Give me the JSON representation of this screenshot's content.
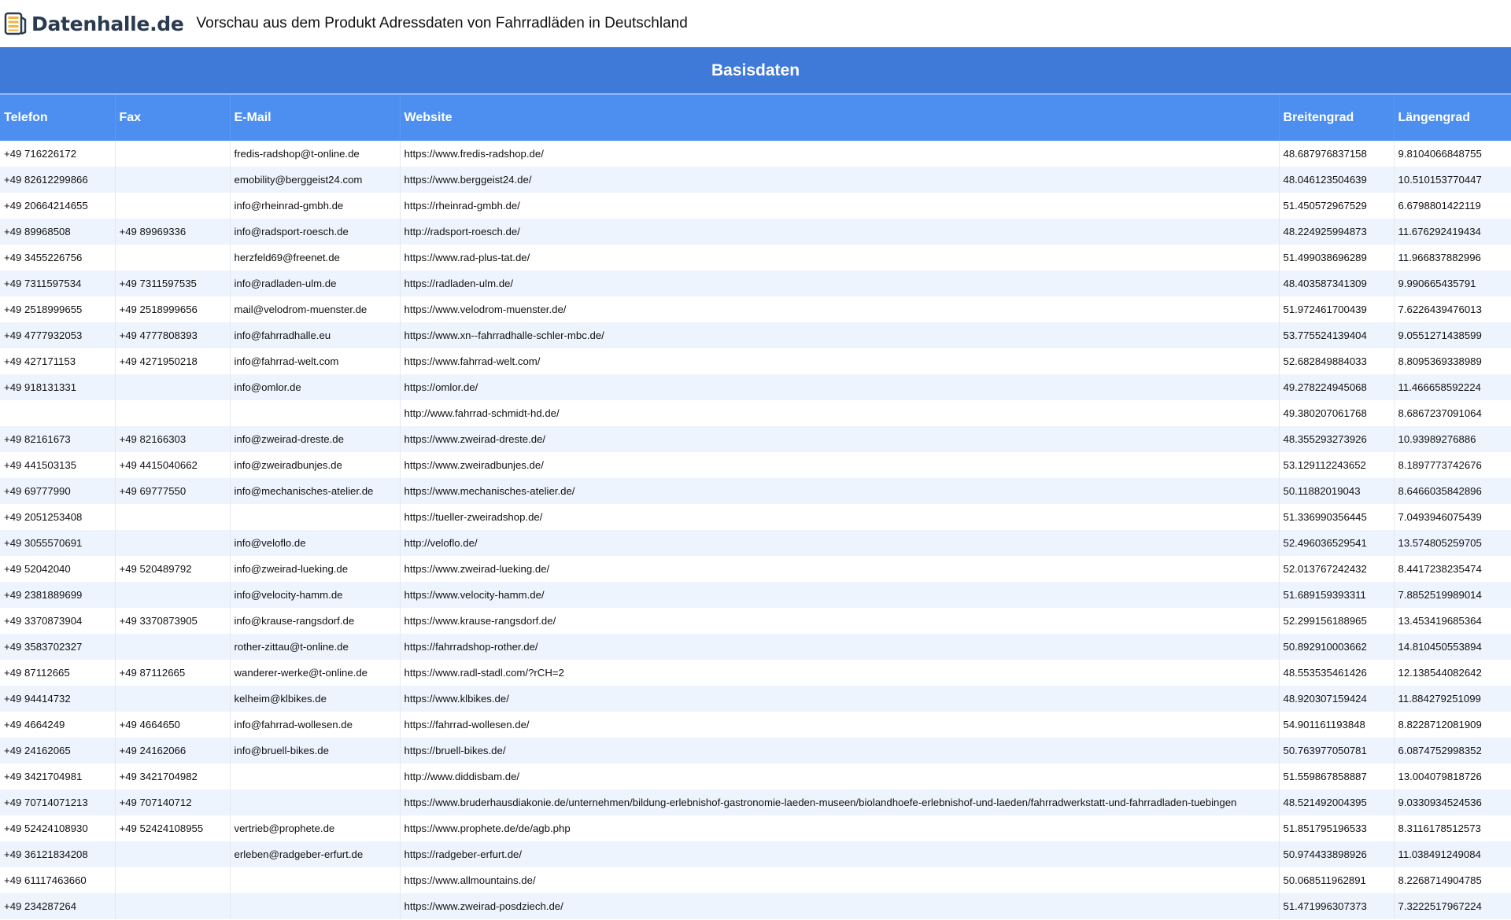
{
  "header": {
    "brand": "Datenhalle.de",
    "title": "Vorschau aus dem Produkt Adressdaten von Fahrradläden in Deutschland",
    "brand_colors": {
      "dark": "#2a3a4f",
      "accent": "#f0b43a"
    }
  },
  "table": {
    "group_title": "Basisdaten",
    "columns": [
      "Telefon",
      "Fax",
      "E-Mail",
      "Website",
      "Breitengrad",
      "Längengrad"
    ],
    "colors": {
      "group_header": "#3f7ad9",
      "column_header": "#4d8ff0",
      "row_alt": "#eef4fd"
    },
    "rows": [
      [
        "+49 716226172",
        "",
        "fredis-radshop@t-online.de",
        "https://www.fredis-radshop.de/",
        "48.687976837158",
        "9.8104066848755"
      ],
      [
        "+49 82612299866",
        "",
        "emobility@berggeist24.com",
        "https://www.berggeist24.de/",
        "48.046123504639",
        "10.510153770447"
      ],
      [
        "+49 20664214655",
        "",
        "info@rheinrad-gmbh.de",
        "https://rheinrad-gmbh.de/",
        "51.450572967529",
        "6.6798801422119"
      ],
      [
        "+49 89968508",
        "+49 89969336",
        "info@radsport-roesch.de",
        "http://radsport-roesch.de/",
        "48.224925994873",
        "11.676292419434"
      ],
      [
        "+49 3455226756",
        "",
        "herzfeld69@freenet.de",
        "https://www.rad-plus-tat.de/",
        "51.499038696289",
        "11.966837882996"
      ],
      [
        "+49 7311597534",
        "+49 7311597535",
        "info@radladen-ulm.de",
        "https://radladen-ulm.de/",
        "48.403587341309",
        "9.990665435791"
      ],
      [
        "+49 2518999655",
        "+49 2518999656",
        "mail@velodrom-muenster.de",
        "https://www.velodrom-muenster.de/",
        "51.972461700439",
        "7.6226439476013"
      ],
      [
        "+49 4777932053",
        "+49 4777808393",
        "info@fahrradhalle.eu",
        "https://www.xn--fahrradhalle-schler-mbc.de/",
        "53.775524139404",
        "9.0551271438599"
      ],
      [
        "+49 427171153",
        "+49 4271950218",
        "info@fahrrad-welt.com",
        "https://www.fahrrad-welt.com/",
        "52.682849884033",
        "8.8095369338989"
      ],
      [
        "+49 918131331",
        "",
        "info@omlor.de",
        "https://omlor.de/",
        "49.278224945068",
        "11.466658592224"
      ],
      [
        "",
        "",
        "",
        "http://www.fahrrad-schmidt-hd.de/",
        "49.380207061768",
        "8.6867237091064"
      ],
      [
        "+49 82161673",
        "+49 82166303",
        "info@zweirad-dreste.de",
        "https://www.zweirad-dreste.de/",
        "48.355293273926",
        "10.93989276886"
      ],
      [
        "+49 441503135",
        "+49 4415040662",
        "info@zweiradbunjes.de",
        "https://www.zweiradbunjes.de/",
        "53.129112243652",
        "8.1897773742676"
      ],
      [
        "+49 69777990",
        "+49 69777550",
        "info@mechanisches-atelier.de",
        "https://www.mechanisches-atelier.de/",
        "50.11882019043",
        "8.6466035842896"
      ],
      [
        "+49 2051253408",
        "",
        "",
        "https://tueller-zweiradshop.de/",
        "51.336990356445",
        "7.0493946075439"
      ],
      [
        "+49 3055570691",
        "",
        "info@veloflo.de",
        "http://veloflo.de/",
        "52.496036529541",
        "13.574805259705"
      ],
      [
        "+49 52042040",
        "+49 520489792",
        "info@zweirad-lueking.de",
        "https://www.zweirad-lueking.de/",
        "52.013767242432",
        "8.4417238235474"
      ],
      [
        "+49 2381889699",
        "",
        "info@velocity-hamm.de",
        "https://www.velocity-hamm.de/",
        "51.689159393311",
        "7.8852519989014"
      ],
      [
        "+49 3370873904",
        "+49 3370873905",
        "info@krause-rangsdorf.de",
        "https://www.krause-rangsdorf.de/",
        "52.299156188965",
        "13.453419685364"
      ],
      [
        "+49 3583702327",
        "",
        "rother-zittau@t-online.de",
        "https://fahrradshop-rother.de/",
        "50.892910003662",
        "14.810450553894"
      ],
      [
        "+49 87112665",
        "+49 87112665",
        "wanderer-werke@t-online.de",
        "https://www.radl-stadl.com/?rCH=2",
        "48.553535461426",
        "12.138544082642"
      ],
      [
        "+49 94414732",
        "",
        "kelheim@klbikes.de",
        "https://www.klbikes.de/",
        "48.920307159424",
        "11.884279251099"
      ],
      [
        "+49 4664249",
        "+49 4664650",
        "info@fahrrad-wollesen.de",
        "https://fahrrad-wollesen.de/",
        "54.901161193848",
        "8.8228712081909"
      ],
      [
        "+49 24162065",
        "+49 24162066",
        "info@bruell-bikes.de",
        "https://bruell-bikes.de/",
        "50.763977050781",
        "6.0874752998352"
      ],
      [
        "+49 3421704981",
        "+49 3421704982",
        "",
        "http://www.diddisbam.de/",
        "51.559867858887",
        "13.004079818726"
      ],
      [
        "+49 70714071213",
        "+49 707140712",
        "",
        "https://www.bruderhausdiakonie.de/unternehmen/bildung-erlebnishof-gastronomie-laeden-museen/biolandhoefe-erlebnishof-und-laeden/fahrradwerkstatt-und-fahrradladen-tuebingen",
        "48.521492004395",
        "9.0330934524536"
      ],
      [
        "+49 52424108930",
        "+49 52424108955",
        "vertrieb@prophete.de",
        "https://www.prophete.de/de/agb.php",
        "51.851795196533",
        "8.3116178512573"
      ],
      [
        "+49 36121834208",
        "",
        "erleben@radgeber-erfurt.de",
        "https://radgeber-erfurt.de/",
        "50.974433898926",
        "11.038491249084"
      ],
      [
        "+49 61117463660",
        "",
        "",
        "https://www.allmountains.de/",
        "50.068511962891",
        "8.2268714904785"
      ],
      [
        "+49 234287264",
        "",
        "",
        "https://www.zweirad-posdziech.de/",
        "51.471996307373",
        "7.3222517967224"
      ]
    ]
  }
}
